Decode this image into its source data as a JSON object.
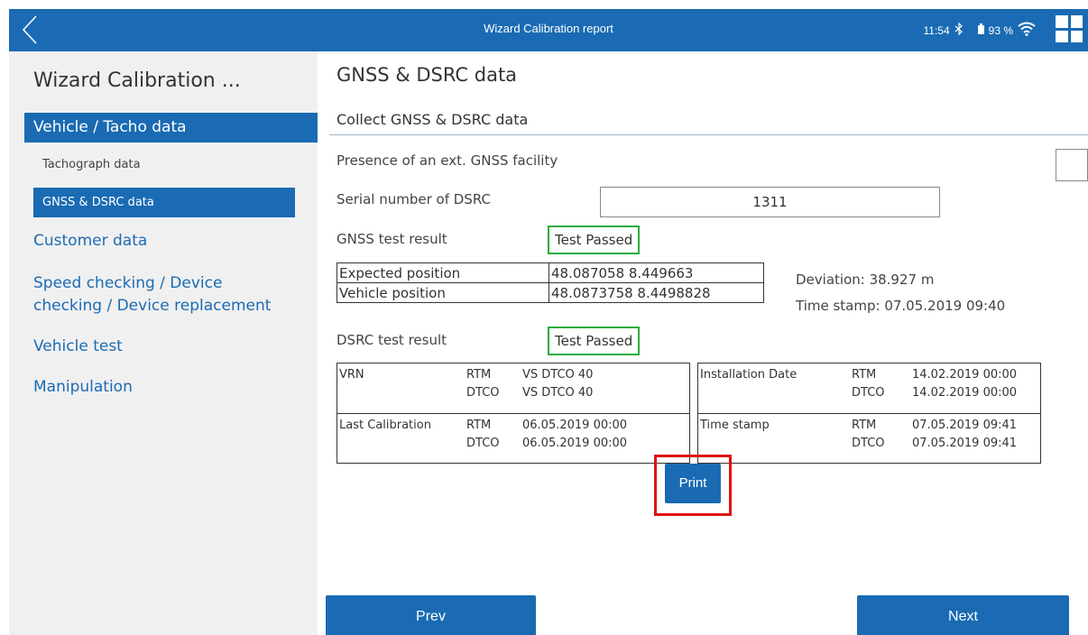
{
  "topbar": {
    "title": "Wizard Calibration report",
    "time": "11:54",
    "battery": "93 %"
  },
  "colors": {
    "accent": "#1a6bb3",
    "passed_border": "#2eac3e",
    "highlight": "#e01010",
    "sidebar_bg": "#f0f0f0"
  },
  "sidebar": {
    "title": "Wizard Calibration ...",
    "items": [
      {
        "label": "Vehicle / Tacho data"
      },
      {
        "label": "Tachograph data"
      },
      {
        "label": "GNSS & DSRC data"
      },
      {
        "label": "Customer data"
      },
      {
        "label": "Speed checking / Device"
      },
      {
        "label": "checking / Device replacement"
      },
      {
        "label": "Vehicle test"
      },
      {
        "label": "Manipulation"
      }
    ]
  },
  "main": {
    "title": "GNSS & DSRC data",
    "subtitle": "Collect GNSS & DSRC data",
    "ext_gnss_label": "Presence of an ext. GNSS facility",
    "serial_label": "Serial number of DSRC",
    "serial_value": "1311",
    "gnss_label": "GNSS test result",
    "gnss_result": "Test Passed",
    "position": {
      "rows": [
        {
          "label": "Expected position",
          "value": "48.087058 8.449663"
        },
        {
          "label": "Vehicle position",
          "value": "48.0873758 8.4498828"
        }
      ],
      "deviation": "Deviation: 38.927 m",
      "timestamp": "Time stamp: 07.05.2019 09:40"
    },
    "dsrc_label": "DSRC test result",
    "dsrc_result": "Test Passed",
    "dsrc_left": [
      {
        "label": "VRN",
        "src1": "RTM",
        "val1": "VS DTCO 40",
        "src2": "DTCO",
        "val2": "VS DTCO 40"
      },
      {
        "label": "Last Calibration",
        "src1": "RTM",
        "val1": "06.05.2019 00:00",
        "src2": "DTCO",
        "val2": "06.05.2019 00:00"
      }
    ],
    "dsrc_right": [
      {
        "label": "Installation Date",
        "src1": "RTM",
        "val1": "14.02.2019 00:00",
        "src2": "DTCO",
        "val2": "14.02.2019 00:00"
      },
      {
        "label": "Time stamp",
        "src1": "RTM",
        "val1": "07.05.2019 09:41",
        "src2": "DTCO",
        "val2": "07.05.2019 09:41"
      }
    ],
    "print_label": "Print",
    "prev_label": "Prev",
    "next_label": "Next"
  }
}
